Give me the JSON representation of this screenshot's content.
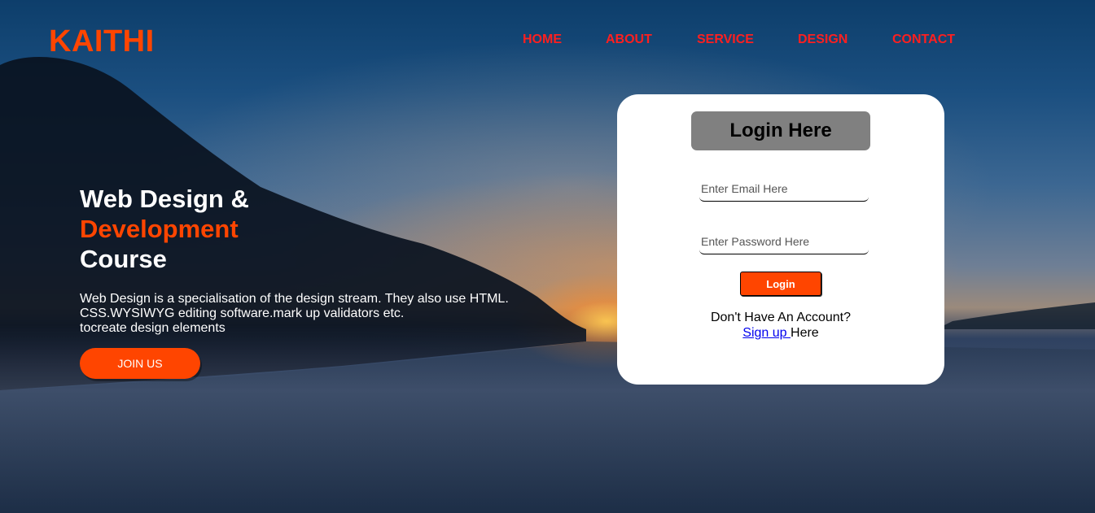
{
  "brand": {
    "logo": "KAITHI",
    "accent_color": "#ff4500",
    "nav_color": "#ff1f1f"
  },
  "nav": {
    "items": [
      {
        "label": "HOME"
      },
      {
        "label": "ABOUT"
      },
      {
        "label": "SERVICE"
      },
      {
        "label": "DESIGN"
      },
      {
        "label": "CONTACT"
      }
    ]
  },
  "hero": {
    "title_line1": "Web Design &",
    "title_line2": "Development",
    "title_line3": "Course",
    "desc_line1": "Web Design is a specialisation of the design stream. They also use HTML.",
    "desc_line2": "CSS.WYSIWYG editing software.mark up validators etc.",
    "desc_line3": "tocreate design elements",
    "cta_label": "JOIN US"
  },
  "login": {
    "title": "Login Here",
    "email_placeholder": "Enter Email Here",
    "password_placeholder": "Enter Password Here",
    "button_label": "Login",
    "no_account_text": "Don't Have An Account?",
    "signup_link": "Sign up ",
    "signup_suffix": "Here"
  }
}
